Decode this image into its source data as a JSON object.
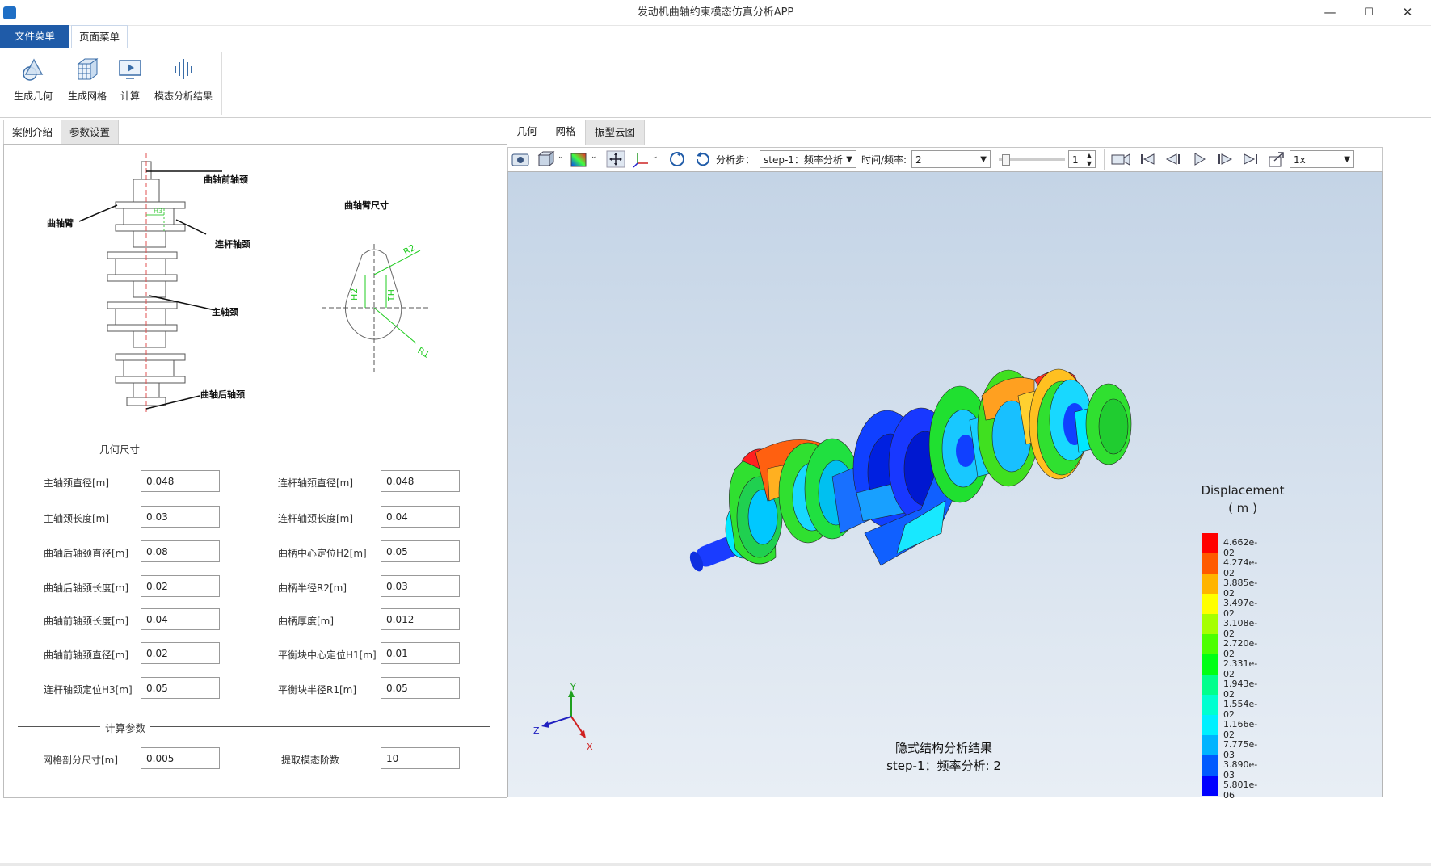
{
  "window": {
    "title": "发动机曲轴约束模态仿真分析APP",
    "minimize": "—",
    "maximize": "☐",
    "close": "✕"
  },
  "menu": {
    "file": "文件菜单",
    "page": "页面菜单"
  },
  "ribbon": [
    {
      "label": "生成几何",
      "icon": "geometry-icon"
    },
    {
      "label": "生成网格",
      "icon": "mesh-icon"
    },
    {
      "label": "计算",
      "icon": "compute-icon"
    },
    {
      "label": "模态分析结果",
      "icon": "modal-result-icon"
    }
  ],
  "left_tabs": [
    "案例介绍",
    "参数设置"
  ],
  "diagram": {
    "front_journal": "曲轴前轴颈",
    "crank_arm": "曲轴臂",
    "rod_journal": "连杆轴颈",
    "main_journal": "主轴颈",
    "rear_journal": "曲轴后轴颈",
    "arm_dims_title": "曲轴臂尺寸",
    "h3": "H3",
    "h1": "H1",
    "h2": "H2",
    "r1": "R1",
    "r2": "R2"
  },
  "geometry_section": "几何尺寸",
  "compute_section": "计算参数",
  "params_left": [
    {
      "label": "主轴颈直径[m]",
      "value": "0.048"
    },
    {
      "label": "主轴颈长度[m]",
      "value": "0.03"
    },
    {
      "label": "曲轴后轴颈直径[m]",
      "value": "0.08"
    },
    {
      "label": "曲轴后轴颈长度[m]",
      "value": "0.02"
    },
    {
      "label": "曲轴前轴颈长度[m]",
      "value": "0.04"
    },
    {
      "label": "曲轴前轴颈直径[m]",
      "value": "0.02"
    },
    {
      "label": "连杆轴颈定位H3[m]",
      "value": "0.05"
    }
  ],
  "params_right": [
    {
      "label": "连杆轴颈直径[m]",
      "value": "0.048"
    },
    {
      "label": "连杆轴颈长度[m]",
      "value": "0.04"
    },
    {
      "label": "曲柄中心定位H2[m]",
      "value": "0.05"
    },
    {
      "label": "曲柄半径R2[m]",
      "value": "0.03"
    },
    {
      "label": "曲柄厚度[m]",
      "value": "0.012"
    },
    {
      "label": "平衡块中心定位H1[m]",
      "value": "0.01"
    },
    {
      "label": "平衡块半径R1[m]",
      "value": "0.05"
    }
  ],
  "compute_params": [
    {
      "label": "网格剖分尺寸[m]",
      "value": "0.005"
    },
    {
      "label": "提取模态阶数",
      "value": "10"
    }
  ],
  "right_tabs": [
    "几何",
    "网格",
    "振型云图"
  ],
  "toolbar": {
    "step_label": "分析步：",
    "step_value": "step-1：频率分析",
    "freq_label": "时间/频率:",
    "freq_value": "2",
    "spin_value": "1",
    "speed_value": "1x"
  },
  "viewport": {
    "result_title": "隐式结构分析结果",
    "result_subtitle": "step-1：频率分析: 2",
    "legend_title": "Displacement",
    "legend_unit": "( m )",
    "axis_x": "X",
    "axis_y": "Y",
    "axis_z": "Z"
  },
  "legend": [
    {
      "value": "4.662e-02",
      "color": "#ff0000"
    },
    {
      "value": "4.274e-02",
      "color": "#ff5a00"
    },
    {
      "value": "3.885e-02",
      "color": "#ffb400"
    },
    {
      "value": "3.497e-02",
      "color": "#ffff00"
    },
    {
      "value": "3.108e-02",
      "color": "#a6ff00"
    },
    {
      "value": "2.720e-02",
      "color": "#4cff00"
    },
    {
      "value": "2.331e-02",
      "color": "#00ff14"
    },
    {
      "value": "1.943e-02",
      "color": "#00ff8c"
    },
    {
      "value": "1.554e-02",
      "color": "#00ffd0"
    },
    {
      "value": "1.166e-02",
      "color": "#00f0ff"
    },
    {
      "value": "7.775e-03",
      "color": "#00b4ff"
    },
    {
      "value": "3.890e-03",
      "color": "#005aff"
    },
    {
      "value": "5.801e-06",
      "color": "#0000ff"
    }
  ]
}
